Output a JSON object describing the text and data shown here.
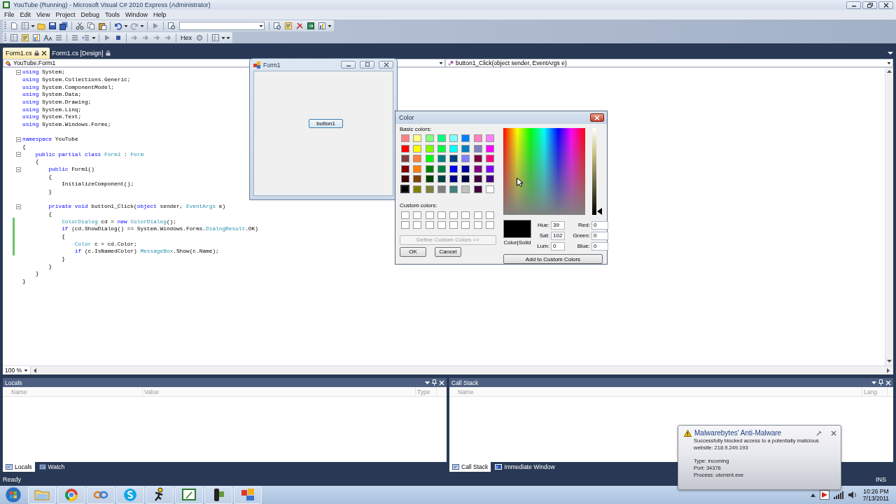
{
  "window": {
    "title": "YouTube (Running) - Microsoft Visual C# 2010 Express (Administrator)"
  },
  "menu": [
    "File",
    "Edit",
    "View",
    "Project",
    "Debug",
    "Tools",
    "Window",
    "Help"
  ],
  "toolbar": {
    "hex_label": "Hex"
  },
  "document_tabs": [
    {
      "label": "Form1.cs",
      "selected": true
    },
    {
      "label": "Form1.cs [Design]",
      "selected": false
    }
  ],
  "navigation": {
    "type_dropdown": "YouTube.Form1",
    "member_dropdown": "button1_Click(object sender, EventArgs e)"
  },
  "code_lines": [
    {
      "kind": "code",
      "fold": true,
      "changed": false,
      "tokens": [
        {
          "kind": "keyword",
          "text": "using"
        },
        {
          "kind": "plain",
          "text": " System;"
        }
      ]
    },
    {
      "kind": "code",
      "fold": false,
      "changed": false,
      "tokens": [
        {
          "kind": "keyword",
          "text": "using"
        },
        {
          "kind": "plain",
          "text": " System.Collections.Generic;"
        }
      ]
    },
    {
      "kind": "code",
      "fold": false,
      "changed": false,
      "tokens": [
        {
          "kind": "keyword",
          "text": "using"
        },
        {
          "kind": "plain",
          "text": " System.ComponentModel;"
        }
      ]
    },
    {
      "kind": "code",
      "fold": false,
      "changed": false,
      "tokens": [
        {
          "kind": "keyword",
          "text": "using"
        },
        {
          "kind": "plain",
          "text": " System.Data;"
        }
      ]
    },
    {
      "kind": "code",
      "fold": false,
      "changed": false,
      "tokens": [
        {
          "kind": "keyword",
          "text": "using"
        },
        {
          "kind": "plain",
          "text": " System.Drawing;"
        }
      ]
    },
    {
      "kind": "code",
      "fold": false,
      "changed": false,
      "tokens": [
        {
          "kind": "keyword",
          "text": "using"
        },
        {
          "kind": "plain",
          "text": " System.Linq;"
        }
      ]
    },
    {
      "kind": "code",
      "fold": false,
      "changed": false,
      "tokens": [
        {
          "kind": "keyword",
          "text": "using"
        },
        {
          "kind": "plain",
          "text": " System.Text;"
        }
      ]
    },
    {
      "kind": "code",
      "fold": false,
      "changed": false,
      "tokens": [
        {
          "kind": "keyword",
          "text": "using"
        },
        {
          "kind": "plain",
          "text": " System.Windows.Forms;"
        }
      ]
    },
    {
      "kind": "blank"
    },
    {
      "kind": "code",
      "fold": true,
      "changed": false,
      "tokens": [
        {
          "kind": "keyword",
          "text": "namespace"
        },
        {
          "kind": "plain",
          "text": " YouTube"
        }
      ]
    },
    {
      "kind": "code",
      "fold": false,
      "changed": false,
      "tokens": [
        {
          "kind": "plain",
          "text": "{"
        }
      ]
    },
    {
      "kind": "code",
      "fold": true,
      "changed": false,
      "tokens": [
        {
          "kind": "keyword",
          "text": "    public partial class "
        },
        {
          "kind": "type",
          "text": "Form1"
        },
        {
          "kind": "plain",
          "text": " : "
        },
        {
          "kind": "type",
          "text": "Form"
        }
      ]
    },
    {
      "kind": "code",
      "fold": false,
      "changed": false,
      "tokens": [
        {
          "kind": "plain",
          "text": "    {"
        }
      ]
    },
    {
      "kind": "code",
      "fold": true,
      "changed": false,
      "tokens": [
        {
          "kind": "keyword",
          "text": "        public"
        },
        {
          "kind": "plain",
          "text": " Form1()"
        }
      ]
    },
    {
      "kind": "code",
      "fold": false,
      "changed": false,
      "tokens": [
        {
          "kind": "plain",
          "text": "        {"
        }
      ]
    },
    {
      "kind": "code",
      "fold": false,
      "changed": false,
      "tokens": [
        {
          "kind": "plain",
          "text": "            InitializeComponent();"
        }
      ]
    },
    {
      "kind": "code",
      "fold": false,
      "changed": false,
      "tokens": [
        {
          "kind": "plain",
          "text": "        }"
        }
      ]
    },
    {
      "kind": "blank"
    },
    {
      "kind": "code",
      "fold": true,
      "changed": false,
      "tokens": [
        {
          "kind": "keyword",
          "text": "        private void"
        },
        {
          "kind": "plain",
          "text": " button1_Click("
        },
        {
          "kind": "keyword",
          "text": "object"
        },
        {
          "kind": "plain",
          "text": " sender, "
        },
        {
          "kind": "type",
          "text": "EventArgs"
        },
        {
          "kind": "plain",
          "text": " e)"
        }
      ]
    },
    {
      "kind": "code",
      "fold": false,
      "changed": false,
      "tokens": [
        {
          "kind": "plain",
          "text": "        {"
        }
      ]
    },
    {
      "kind": "code",
      "fold": false,
      "changed": true,
      "tokens": [
        {
          "kind": "type",
          "text": "            ColorDialog"
        },
        {
          "kind": "plain",
          "text": " cd = "
        },
        {
          "kind": "keyword",
          "text": "new "
        },
        {
          "kind": "type",
          "text": "ColorDialog"
        },
        {
          "kind": "plain",
          "text": "();"
        }
      ]
    },
    {
      "kind": "code",
      "fold": false,
      "changed": true,
      "tokens": [
        {
          "kind": "keyword",
          "text": "            if"
        },
        {
          "kind": "plain",
          "text": " (cd.ShowDialog() == System.Windows.Forms."
        },
        {
          "kind": "type",
          "text": "DialogResult"
        },
        {
          "kind": "plain",
          "text": ".OK)"
        }
      ]
    },
    {
      "kind": "code",
      "fold": false,
      "changed": true,
      "tokens": [
        {
          "kind": "plain",
          "text": "            {"
        }
      ]
    },
    {
      "kind": "code",
      "fold": false,
      "changed": true,
      "tokens": [
        {
          "kind": "type",
          "text": "                Color"
        },
        {
          "kind": "plain",
          "text": " c = cd.Color;"
        }
      ]
    },
    {
      "kind": "code",
      "fold": false,
      "changed": true,
      "tokens": [
        {
          "kind": "keyword",
          "text": "                if"
        },
        {
          "kind": "plain",
          "text": " (c.IsNamedColor) "
        },
        {
          "kind": "type",
          "text": "MessageBox"
        },
        {
          "kind": "plain",
          "text": ".Show(c.Name);"
        }
      ]
    },
    {
      "kind": "code",
      "fold": false,
      "changed": false,
      "tokens": [
        {
          "kind": "plain",
          "text": "            }"
        }
      ]
    },
    {
      "kind": "code",
      "fold": false,
      "changed": false,
      "tokens": [
        {
          "kind": "plain",
          "text": "        }"
        }
      ]
    },
    {
      "kind": "code",
      "fold": false,
      "changed": false,
      "tokens": [
        {
          "kind": "plain",
          "text": "    }"
        }
      ]
    },
    {
      "kind": "code",
      "fold": false,
      "changed": false,
      "tokens": [
        {
          "kind": "plain",
          "text": "}"
        }
      ]
    }
  ],
  "zoom": "100 %",
  "panes": [
    {
      "title": "Locals",
      "columns": [
        "Name",
        "Value",
        "Type"
      ],
      "tabs": [
        {
          "label": "Locals",
          "selected": true
        },
        {
          "label": "Watch",
          "selected": false
        }
      ]
    },
    {
      "title": "Call Stack",
      "columns": [
        "Name",
        "Lang"
      ],
      "tabs": [
        {
          "label": "Call Stack",
          "selected": true
        },
        {
          "label": "Immediate Window",
          "selected": false
        }
      ]
    }
  ],
  "status_bar": {
    "state": "Ready",
    "mode": "INS"
  },
  "form_window": {
    "title": "Form1",
    "button": "button1"
  },
  "color_dialog": {
    "title": "Color",
    "basic_label": "Basic colors:",
    "basic_colors": [
      {
        "color": "#ff8080",
        "selected": false
      },
      {
        "color": "#ffff80",
        "selected": false
      },
      {
        "color": "#80ff80",
        "selected": false
      },
      {
        "color": "#00ff80",
        "selected": false
      },
      {
        "color": "#80ffff",
        "selected": false
      },
      {
        "color": "#0080ff",
        "selected": false
      },
      {
        "color": "#ff80c0",
        "selected": false
      },
      {
        "color": "#ff80ff",
        "selected": false
      },
      {
        "color": "#ff0000",
        "selected": false
      },
      {
        "color": "#ffff00",
        "selected": false
      },
      {
        "color": "#80ff00",
        "selected": false
      },
      {
        "color": "#00ff40",
        "selected": false
      },
      {
        "color": "#00ffff",
        "selected": false
      },
      {
        "color": "#0080c0",
        "selected": false
      },
      {
        "color": "#8080c0",
        "selected": false
      },
      {
        "color": "#ff00ff",
        "selected": false
      },
      {
        "color": "#804040",
        "selected": false
      },
      {
        "color": "#ff8040",
        "selected": false
      },
      {
        "color": "#00ff00",
        "selected": false
      },
      {
        "color": "#008080",
        "selected": false
      },
      {
        "color": "#004080",
        "selected": false
      },
      {
        "color": "#8080ff",
        "selected": false
      },
      {
        "color": "#800040",
        "selected": false
      },
      {
        "color": "#ff0080",
        "selected": false
      },
      {
        "color": "#800000",
        "selected": false
      },
      {
        "color": "#ff8000",
        "selected": false
      },
      {
        "color": "#008000",
        "selected": false
      },
      {
        "color": "#008040",
        "selected": false
      },
      {
        "color": "#0000ff",
        "selected": false
      },
      {
        "color": "#0000a0",
        "selected": false
      },
      {
        "color": "#800080",
        "selected": false
      },
      {
        "color": "#8000ff",
        "selected": false
      },
      {
        "color": "#400000",
        "selected": false
      },
      {
        "color": "#804000",
        "selected": false
      },
      {
        "color": "#004000",
        "selected": false
      },
      {
        "color": "#004040",
        "selected": false
      },
      {
        "color": "#000080",
        "selected": false
      },
      {
        "color": "#000040",
        "selected": false
      },
      {
        "color": "#400040",
        "selected": false
      },
      {
        "color": "#400080",
        "selected": false
      },
      {
        "color": "#000000",
        "selected": true
      },
      {
        "color": "#808000",
        "selected": false
      },
      {
        "color": "#808040",
        "selected": false
      },
      {
        "color": "#808080",
        "selected": false
      },
      {
        "color": "#408080",
        "selected": false
      },
      {
        "color": "#c0c0c0",
        "selected": false
      },
      {
        "color": "#400040",
        "selected": false
      },
      {
        "color": "#ffffff",
        "selected": false
      }
    ],
    "custom_label": "Custom colors:",
    "define_button": {
      "label": "Define Custom Colors >>",
      "disabled": true
    },
    "ok": "OK",
    "cancel": "Cancel",
    "preview_label": "Color|Solid",
    "luminance": {
      "level": 0
    },
    "fields": [
      {
        "label": "Hue:",
        "value": "39"
      },
      {
        "label": "Red:",
        "value": "0"
      },
      {
        "label": "Sat:",
        "value": "102"
      },
      {
        "label": "Green:",
        "value": "0"
      },
      {
        "label": "Lum:",
        "value": "0"
      },
      {
        "label": "Blue:",
        "value": "0"
      }
    ],
    "add_button": "Add to Custom Colors"
  },
  "notification": {
    "title": "Malwarebytes' Anti-Malware",
    "message": "Successfully blocked access to a potentially malicious website: 218.9.249.193",
    "details": [
      "Type: incoming",
      "Port: 34376",
      "Process: utorrent.exe"
    ]
  },
  "taskbar": {
    "time": "10:26 PM",
    "date": "7/13/2011"
  }
}
